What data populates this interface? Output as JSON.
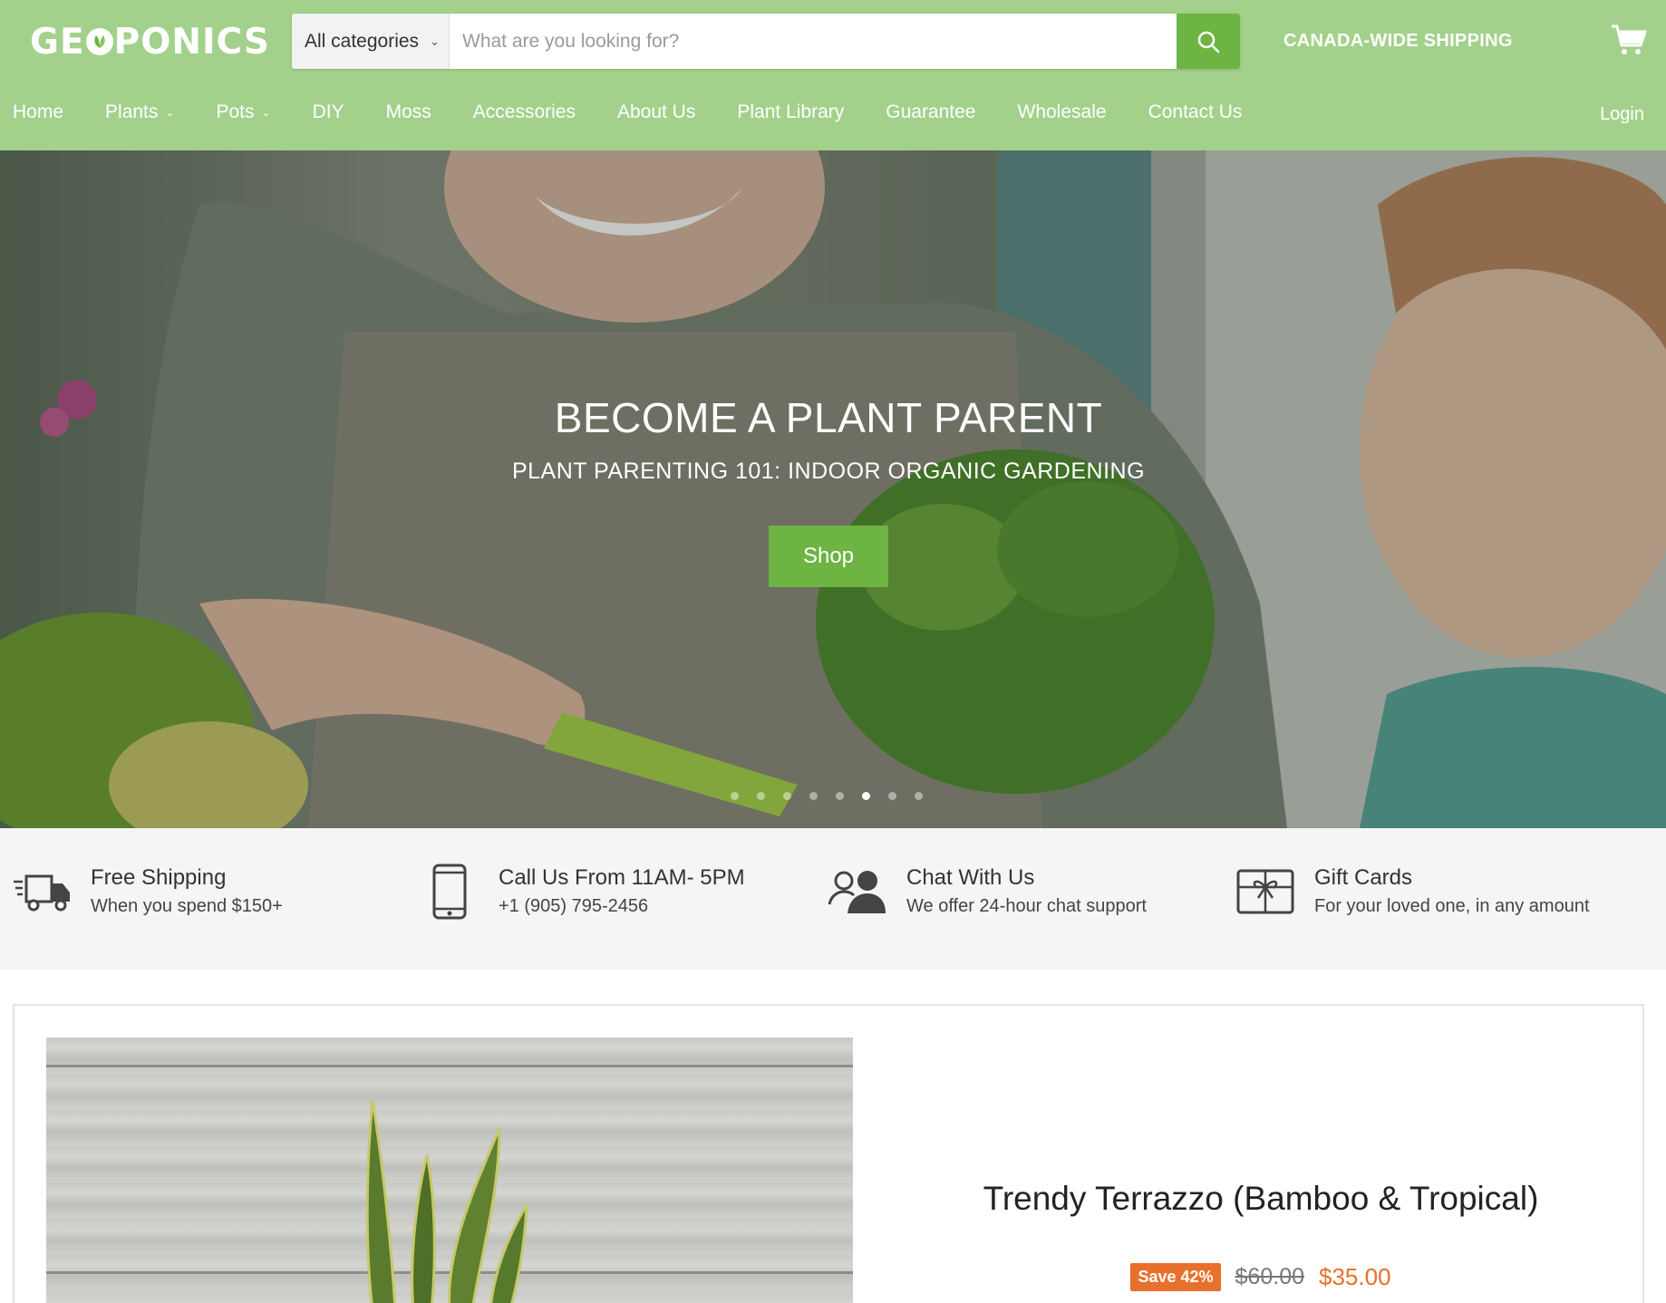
{
  "header": {
    "logo_text_left": "GE",
    "logo_text_right": "PONICS",
    "search": {
      "category": "All categories",
      "placeholder": "What are you looking for?"
    },
    "shipping_text": "CANADA-WIDE SHIPPING",
    "login": "Login"
  },
  "nav": {
    "items": [
      {
        "label": "Home",
        "dropdown": false
      },
      {
        "label": "Plants",
        "dropdown": true
      },
      {
        "label": "Pots",
        "dropdown": true
      },
      {
        "label": "DIY",
        "dropdown": false
      },
      {
        "label": "Moss",
        "dropdown": false
      },
      {
        "label": "Accessories",
        "dropdown": false
      },
      {
        "label": "About Us",
        "dropdown": false
      },
      {
        "label": "Plant Library",
        "dropdown": false
      },
      {
        "label": "Guarantee",
        "dropdown": false
      },
      {
        "label": "Wholesale",
        "dropdown": false
      },
      {
        "label": "Contact Us",
        "dropdown": false
      }
    ]
  },
  "hero": {
    "title": "BECOME A PLANT PARENT",
    "subtitle": "PLANT PARENTING 101: INDOOR ORGANIC GARDENING",
    "button": "Shop",
    "slide_count": 8,
    "active_slide": 6
  },
  "features": [
    {
      "icon": "truck-icon",
      "title": "Free Shipping",
      "subtitle": "When you spend $150+"
    },
    {
      "icon": "phone-icon",
      "title": "Call Us From 11AM- 5PM",
      "subtitle": "+1 (905) 795-2456"
    },
    {
      "icon": "chat-users-icon",
      "title": "Chat With Us",
      "subtitle": "We offer 24-hour chat support"
    },
    {
      "icon": "gift-card-icon",
      "title": "Gift Cards",
      "subtitle": "For your loved one, in any amount"
    }
  ],
  "product": {
    "title": "Trendy Terrazzo (Bamboo & Tropical)",
    "save_badge": "Save 42%",
    "old_price": "$60.00",
    "new_price": "$35.00"
  },
  "colors": {
    "header_bg": "#a3d18b",
    "accent_green": "#6db442",
    "sale_orange": "#e8702a"
  }
}
